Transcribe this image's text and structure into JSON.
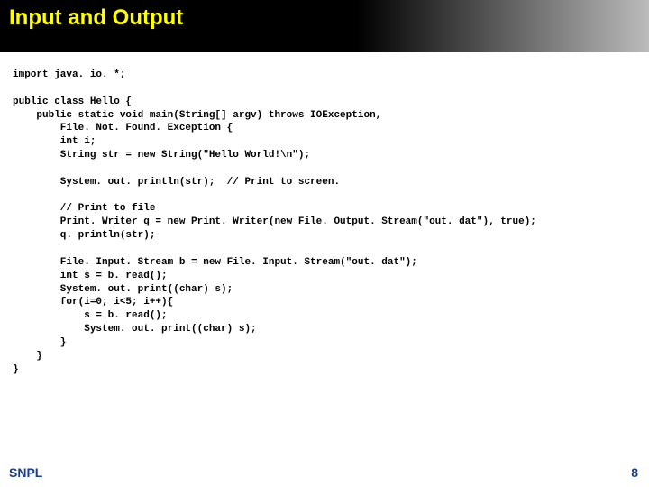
{
  "header": {
    "title": "Input and Output"
  },
  "code": {
    "text": "import java. io. *;\n\npublic class Hello {\n    public static void main(String[] argv) throws IOException,\n        File. Not. Found. Exception {\n        int i;\n        String str = new String(\"Hello World!\\n\");\n\n        System. out. println(str);  // Print to screen.\n\n        // Print to file\n        Print. Writer q = new Print. Writer(new File. Output. Stream(\"out. dat\"), true);\n        q. println(str);\n\n        File. Input. Stream b = new File. Input. Stream(\"out. dat\");\n        int s = b. read();\n        System. out. print((char) s);\n        for(i=0; i<5; i++){\n            s = b. read();\n            System. out. print((char) s);\n        }\n    }\n}"
  },
  "footer": {
    "left": "SNPL",
    "right": "8"
  }
}
